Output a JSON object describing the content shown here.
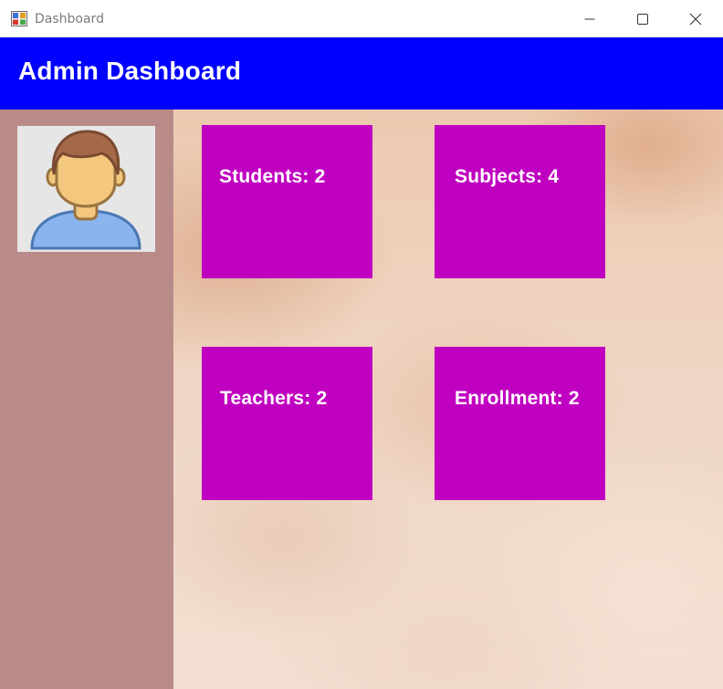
{
  "window": {
    "title": "Dashboard",
    "app_icon": "winforms-app-icon",
    "controls": {
      "minimize_icon": "minimize-icon",
      "maximize_icon": "maximize-icon",
      "close_icon": "close-icon"
    }
  },
  "header": {
    "title": "Admin Dashboard",
    "background_color": "#0000ff"
  },
  "sidebar": {
    "background_color": "#b98b88",
    "avatar_icon": "user-avatar-icon"
  },
  "tiles": [
    {
      "label": "Students:  2",
      "color": "#c000c0"
    },
    {
      "label": "Subjects: 4",
      "color": "#c000c0"
    },
    {
      "label": "Teachers:  2",
      "color": "#c000c0"
    },
    {
      "label": "Enrollment: 2",
      "color": "#c000c0"
    }
  ]
}
